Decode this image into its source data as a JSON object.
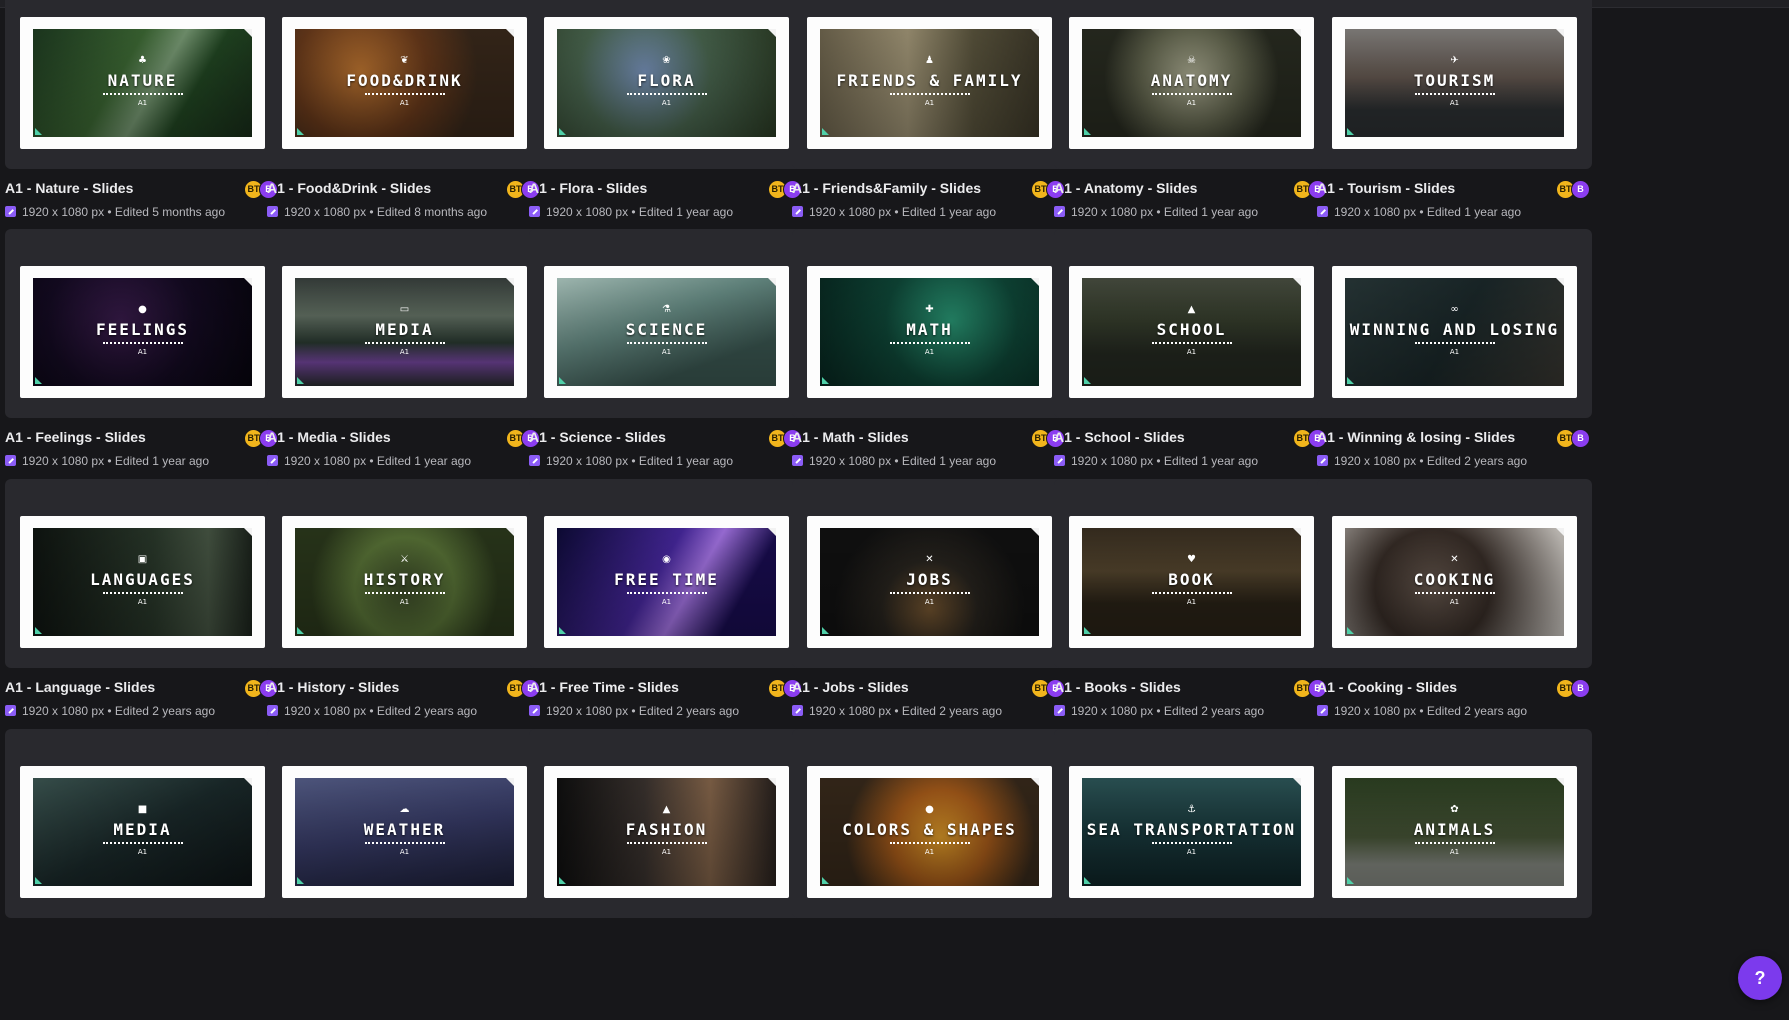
{
  "help_button": {
    "label": "?"
  },
  "designs": [
    {
      "thumb_title": "NATURE",
      "thumb_icon": "♣",
      "name": "A1 - Nature - Slides",
      "meta": "1920 x 1080 px • Edited 5 months ago",
      "bg": "bg-nature"
    },
    {
      "thumb_title": "FOOD&DRINK",
      "thumb_icon": "❦",
      "name": "A1 - Food&Drink - Slides",
      "meta": "1920 x 1080 px • Edited 8 months ago",
      "bg": "bg-food"
    },
    {
      "thumb_title": "FLORA",
      "thumb_icon": "❀",
      "name": "A1 - Flora - Slides",
      "meta": "1920 x 1080 px • Edited 1 year ago",
      "bg": "bg-flora"
    },
    {
      "thumb_title": "FRIENDS & FAMILY",
      "thumb_icon": "♟",
      "name": "A1 - Friends&Family  - Slides",
      "meta": "1920 x 1080 px • Edited 1 year ago",
      "bg": "bg-friends"
    },
    {
      "thumb_title": "ANATOMY",
      "thumb_icon": "☠",
      "name": "A1 - Anatomy - Slides",
      "meta": "1920 x 1080 px • Edited 1 year ago",
      "bg": "bg-anatomy"
    },
    {
      "thumb_title": "TOURISM",
      "thumb_icon": "✈",
      "name": "A1 - Tourism - Slides",
      "meta": "1920 x 1080 px • Edited 1 year ago",
      "bg": "bg-tourism"
    },
    {
      "thumb_title": "FEELINGS",
      "thumb_icon": "●",
      "name": "A1 - Feelings - Slides",
      "meta": "1920 x 1080 px • Edited 1 year ago",
      "bg": "bg-feelings"
    },
    {
      "thumb_title": "MEDIA",
      "thumb_icon": "▭",
      "name": "A1  - Media - Slides",
      "meta": "1920 x 1080 px • Edited 1 year ago",
      "bg": "bg-media"
    },
    {
      "thumb_title": "SCIENCE",
      "thumb_icon": "⚗",
      "name": "A1 - Science - Slides",
      "meta": "1920 x 1080 px • Edited 1 year ago",
      "bg": "bg-science"
    },
    {
      "thumb_title": "MATH",
      "thumb_icon": "✚",
      "name": "A1 - Math - Slides",
      "meta": "1920 x 1080 px • Edited 1 year ago",
      "bg": "bg-math"
    },
    {
      "thumb_title": "SCHOOL",
      "thumb_icon": "▲",
      "name": "A1 - School - Slides",
      "meta": "1920 x 1080 px • Edited 1 year ago",
      "bg": "bg-school"
    },
    {
      "thumb_title": "WINNING AND LOSING",
      "thumb_icon": "∞",
      "name": "A1  - Winning & losing - Slides",
      "meta": "1920 x 1080 px • Edited 2 years ago",
      "bg": "bg-winning"
    },
    {
      "thumb_title": "LANGUAGES",
      "thumb_icon": "▣",
      "name": "A1  - Language - Slides",
      "meta": "1920 x 1080 px • Edited 2 years ago",
      "bg": "bg-lang"
    },
    {
      "thumb_title": "HISTORY",
      "thumb_icon": "⚔",
      "name": "A1 - History - Slides",
      "meta": "1920 x 1080 px • Edited 2 years ago",
      "bg": "bg-history"
    },
    {
      "thumb_title": "FREE TIME",
      "thumb_icon": "◉",
      "name": "A1 - Free Time - Slides",
      "meta": "1920 x 1080 px • Edited 2 years ago",
      "bg": "bg-free"
    },
    {
      "thumb_title": "JOBS",
      "thumb_icon": "✕",
      "name": "A1  - Jobs - Slides",
      "meta": "1920 x 1080 px • Edited 2 years ago",
      "bg": "bg-jobs"
    },
    {
      "thumb_title": "BOOK",
      "thumb_icon": "♥",
      "name": "A1 - Books - Slides",
      "meta": "1920 x 1080 px • Edited 2 years ago",
      "bg": "bg-book"
    },
    {
      "thumb_title": "COOKING",
      "thumb_icon": "✕",
      "name": "A1 - Cooking - Slides",
      "meta": "1920 x 1080 px • Edited 2 years ago",
      "bg": "bg-cooking"
    },
    {
      "thumb_title": "MEDIA",
      "thumb_icon": "■",
      "name": "",
      "meta": "",
      "bg": "bg-media2"
    },
    {
      "thumb_title": "WEATHER",
      "thumb_icon": "☁",
      "name": "",
      "meta": "",
      "bg": "bg-weather"
    },
    {
      "thumb_title": "FASHION",
      "thumb_icon": "▲",
      "name": "",
      "meta": "",
      "bg": "bg-fashion"
    },
    {
      "thumb_title": "COLORS & SHAPES",
      "thumb_icon": "●",
      "name": "",
      "meta": "",
      "bg": "bg-colors"
    },
    {
      "thumb_title": "SEA TRANSPORTATION",
      "thumb_icon": "⚓",
      "name": "",
      "meta": "",
      "bg": "bg-sea"
    },
    {
      "thumb_title": "ANIMALS",
      "thumb_icon": "✿",
      "name": "",
      "meta": "",
      "bg": "bg-animals"
    }
  ],
  "avatar_labels": [
    "BT",
    "B"
  ],
  "thumb_small_text": "A1",
  "colors": {
    "background": "#17171a",
    "card": "#29292e",
    "accent": "#7c3aed",
    "avatar_primary": "#f1b51c",
    "avatar_secondary": "#8b3df0"
  }
}
